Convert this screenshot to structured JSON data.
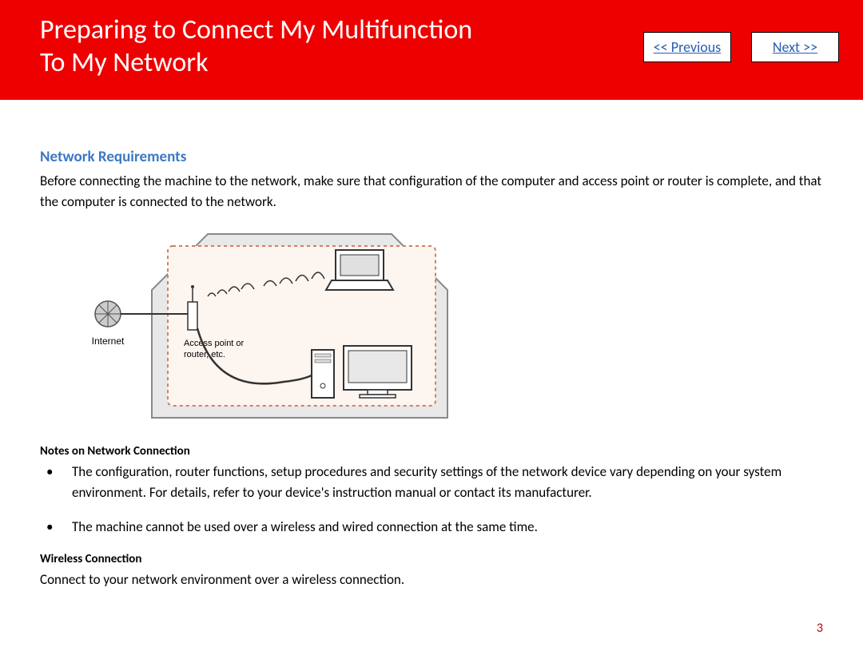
{
  "header": {
    "title_line1": "Preparing to Connect My Multifunction",
    "title_line2": "To My Network",
    "previous_label": "<< Previous",
    "next_label": "Next >>"
  },
  "content": {
    "section_heading": "Network Requirements",
    "intro_text": "Before connecting the machine to the network, make sure that configuration of the computer and access point or router is complete, and that the computer is connected to the network.",
    "diagram": {
      "internet_label": "Internet",
      "router_label": "Access point or\nrouter, etc."
    },
    "notes_heading": "Notes on Network Connection",
    "notes": [
      "The configuration, router functions, setup procedures and security settings of the network device vary depending on your system environment. For details, refer to your device's instruction manual or contact its manufacturer.",
      "The machine cannot be used over a wireless and wired connection at the same time."
    ],
    "wireless_heading": "Wireless Connection",
    "wireless_text": "Connect to your network environment over a wireless connection."
  },
  "page_number": "3"
}
